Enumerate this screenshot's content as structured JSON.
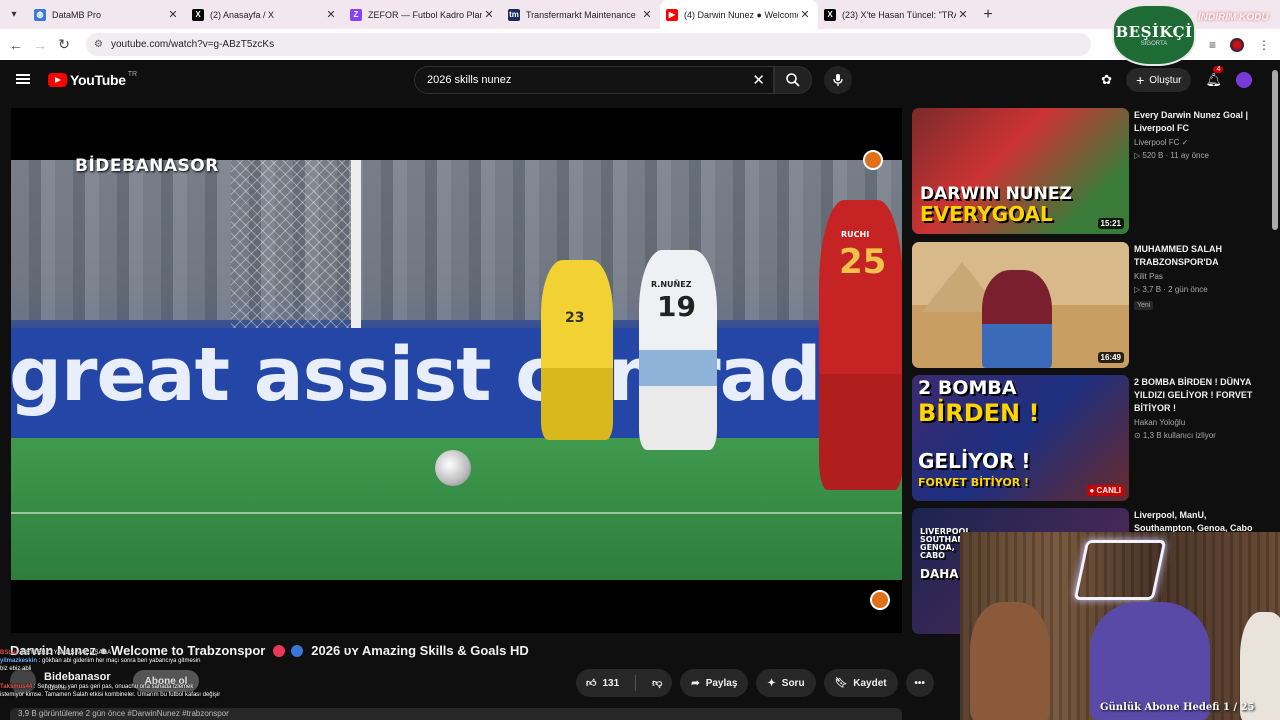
{
  "tabs": [
    {
      "title": "DataMB Pro",
      "favicon_color": "#3a7bd5",
      "active": false
    },
    {
      "title": "(2) Anasayfa / X",
      "favicon_color": "#000000",
      "active": false
    },
    {
      "title": "ZEFOR — Futbol Kadro Planlam",
      "favicon_color": "#8a3ffc",
      "active": false
    },
    {
      "title": "Transfermarkt Maintenance",
      "favicon_color": "#1a2a5a",
      "active": false
    },
    {
      "title": "(4) Darwin Nunez ● Welcome to",
      "favicon_color": "#ff0000",
      "active": true
    },
    {
      "title": "(23) X'te Hasan Tüncel: \"TRABZ",
      "favicon_color": "#000000",
      "active": false
    }
  ],
  "address": {
    "url": "youtube.com/watch?v=g-ABzT5zcKs"
  },
  "header": {
    "logo_text": "YouTube",
    "region": "TR",
    "search_value": "2026 skills nunez",
    "create_label": "Oluştur",
    "notification_count": "4"
  },
  "video": {
    "watermark": "BİDEBANASOR",
    "board_text": "great assist comrad t",
    "jersey_keeper": "23",
    "jersey_striker": "19",
    "jersey_striker_name": "R.NUÑEZ",
    "jersey_defender": "25",
    "jersey_defender_name": "RUCHI",
    "title_prefix": "Darwin Nunez ● Welcome to Trabzonspor",
    "title_suffix": "2026 ᴜʏ Amazing Skills & Goals HD",
    "dot_colors": [
      "#e8385a",
      "#3a76d8"
    ]
  },
  "channel": {
    "name": "Bidebanasor",
    "subs": "Abone",
    "subscribe_label": "Abone ol"
  },
  "actions": {
    "likes": "131",
    "share": "Paylaş",
    "ask": "Soru",
    "save": "Kaydet"
  },
  "description_peek": "3,9 B görüntüleme  2 gün önce  #DarwinNunez #trabzonspor",
  "chat": [
    {
      "user": "BSLvi",
      "text": "BEYLER O YANLIŞ MAÇLIŞAĞA",
      "blue": false
    },
    {
      "user": "yilmazkeskin",
      "text": "gökhan abi gideriim her maçı sonra ben yabancıya gitmesin",
      "blue": true
    },
    {
      "user": "",
      "text": "biz ebiz abli",
      "blue": false
    },
    {
      "user": "Taksmus44",
      "text": "Set oyunu, yan pas geri pas, onuachu orta sahada izlemek",
      "blue": false
    },
    {
      "user": "",
      "text": "istemiyor kimse. Tamamen Salah etkisi kombineler. Umarım bu futbol kafası değişir",
      "blue": false
    }
  ],
  "recommendations": [
    {
      "title": "Every Darwin Nunez Goal | Liverpool FC",
      "channel": "Liverpool FC ✓",
      "views": "▷ 520 B · 11 ay önce",
      "duration": "15:21",
      "thumb_line1": "DARWIN NUNEZ",
      "thumb_line2": "EVERYGOAL",
      "new": "",
      "live": false
    },
    {
      "title": "MUHAMMED SALAH TRABZONSPOR'DA",
      "channel": "Kilit Pas",
      "views": "▷ 3,7 B · 2 gün önce",
      "duration": "16:49",
      "thumb_line1": "",
      "thumb_line2": "",
      "new": "Yeni",
      "live": false
    },
    {
      "title": "2 BOMBA BİRDEN ! DÜNYA YILDIZI GELİYOR ! FORVET BİTİYOR !",
      "channel": "Hakan Yoloğlu",
      "views": "⊙ 1,3 B kullanıcı izliyor",
      "duration": "● CANLI",
      "thumb_line1": "2 BOMBA",
      "thumb_line2": "BİRDEN !",
      "thumb_line3": "GELİYOR !",
      "thumb_line4": "FORVET BİTİYOR !",
      "new": "",
      "live": true
    },
    {
      "title": "Liverpool, ManU, Southampton, Genoa, Cabo",
      "channel": "",
      "views": "",
      "duration": "",
      "thumb_line1": "LIVERPOOL SOUTHAMPTON GENOA, CABO",
      "thumb_line2": "DAHA",
      "new": "",
      "live": false
    }
  ],
  "overlay": {
    "badge_text": "BEŞİKÇİ",
    "badge_sub": "SİGORTA",
    "promo": "İNDİRİM KODU",
    "goal_counter": "Günlük Abone Hedefi 1 / 25"
  }
}
